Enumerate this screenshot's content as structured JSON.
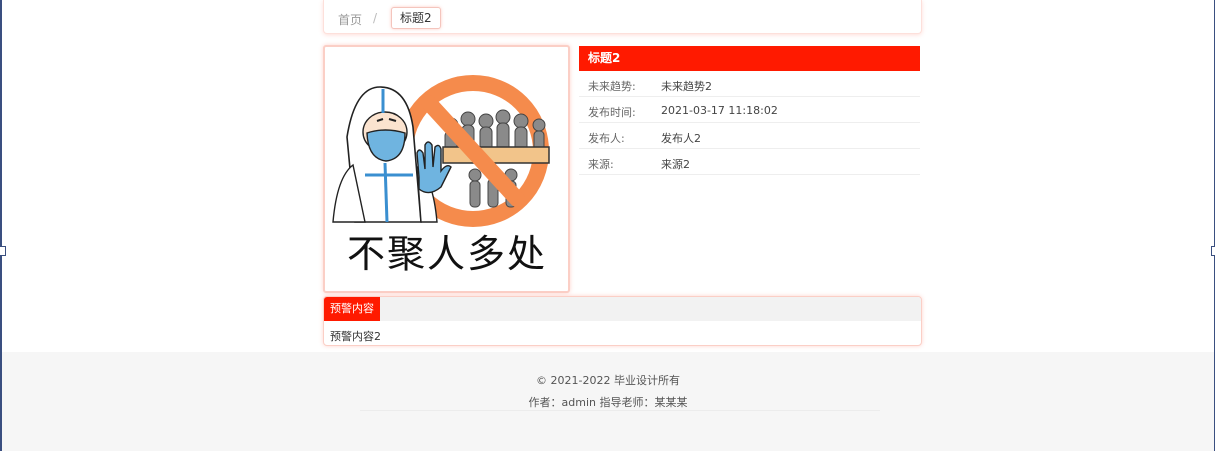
{
  "breadcrumb": {
    "home": "首页",
    "separator": "/",
    "current": "标题2"
  },
  "image": {
    "caption": "不聚人多处"
  },
  "detail": {
    "title": "标题2",
    "rows": [
      {
        "label": "未来趋势:",
        "value": "未来趋势2"
      },
      {
        "label": "发布时间:",
        "value": "2021-03-17 11:18:02"
      },
      {
        "label": "发布人:",
        "value": "发布人2"
      },
      {
        "label": "来源:",
        "value": "来源2"
      }
    ]
  },
  "content": {
    "tab_label": "预警内容",
    "text": "预警内容2"
  },
  "footer": {
    "copyright": "© 2021-2022 毕业设计所有",
    "authors": "作者：admin 指导老师：某某某"
  },
  "colors": {
    "accent": "#ff1a00",
    "border": "#fbcfc6",
    "footer_bg": "#f6f6f6"
  }
}
